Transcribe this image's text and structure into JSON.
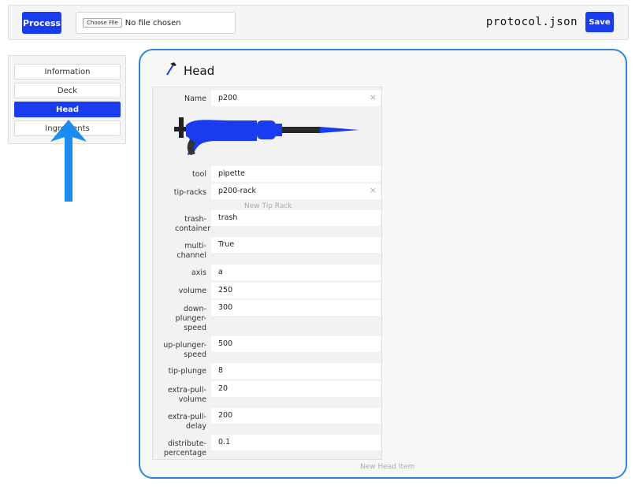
{
  "toolbar": {
    "process_label": "Process",
    "choose_file_label": "Choose File",
    "file_status": "No file chosen",
    "filename": "protocol.json",
    "save_label": "Save"
  },
  "sidebar": {
    "items": [
      {
        "label": "Information"
      },
      {
        "label": "Deck"
      },
      {
        "label": "Head",
        "active": true
      },
      {
        "label": "Ingredients"
      }
    ]
  },
  "head": {
    "title": "Head",
    "name_label": "Name",
    "name_value": "p200",
    "fields": [
      {
        "label": "tool",
        "value": "pipette"
      },
      {
        "label": "tip-racks",
        "value": "p200-rack"
      },
      {
        "label": "trash-container",
        "value": "trash"
      },
      {
        "label": "multi-channel",
        "value": "True"
      },
      {
        "label": "axis",
        "value": "a"
      },
      {
        "label": "volume",
        "value": "250"
      },
      {
        "label": "down-plunger-speed",
        "value": "300"
      },
      {
        "label": "up-plunger-speed",
        "value": "500"
      },
      {
        "label": "tip-plunge",
        "value": "8"
      },
      {
        "label": "extra-pull-volume",
        "value": "20"
      },
      {
        "label": "extra-pull-delay",
        "value": "200"
      },
      {
        "label": "distribute-percentage",
        "value": "0.1"
      }
    ],
    "new_tip_rack_label": "New Tip Rack",
    "new_head_item_label": "New Head Item"
  },
  "colors": {
    "accent": "#1a3cf0",
    "annotation_arrow": "#1a8cf0",
    "panel_border": "#2c86e0"
  }
}
